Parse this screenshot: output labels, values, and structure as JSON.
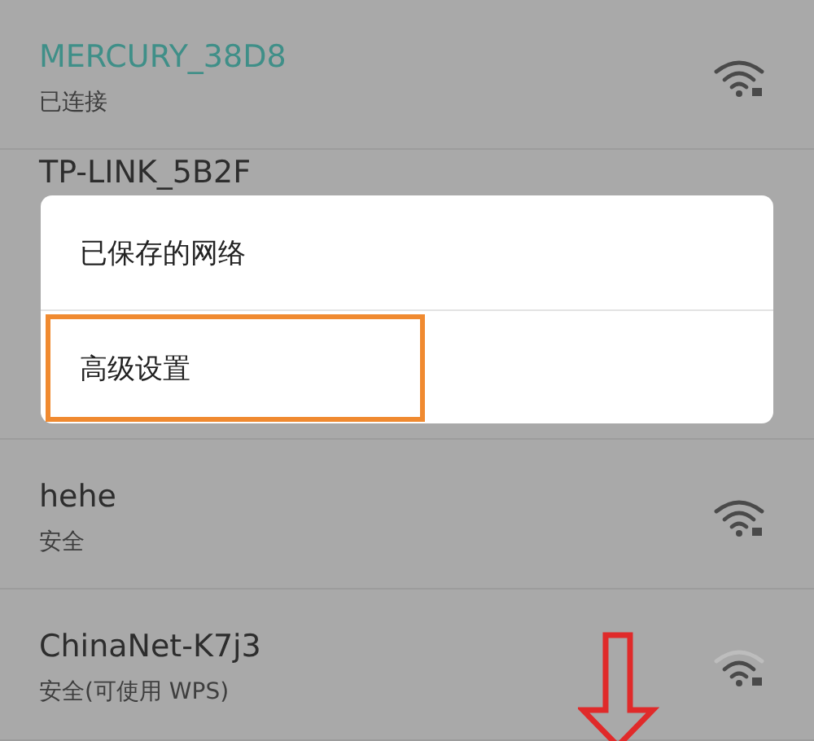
{
  "networks": [
    {
      "name": "MERCURY_38D8",
      "status": "已连接",
      "connected": true,
      "kind": "strong"
    },
    {
      "name": "TP-LINK_5B2F",
      "connected": false
    },
    {
      "name": "hehe",
      "status": "安全",
      "connected": false,
      "kind": "strong"
    },
    {
      "name": "ChinaNet-K7j3",
      "status": "安全(可使用 WPS)",
      "connected": false,
      "kind": "weak"
    }
  ],
  "menu": {
    "items": [
      {
        "label": "已保存的网络",
        "highlighted": false
      },
      {
        "label": "高级设置",
        "highlighted": true
      }
    ]
  }
}
